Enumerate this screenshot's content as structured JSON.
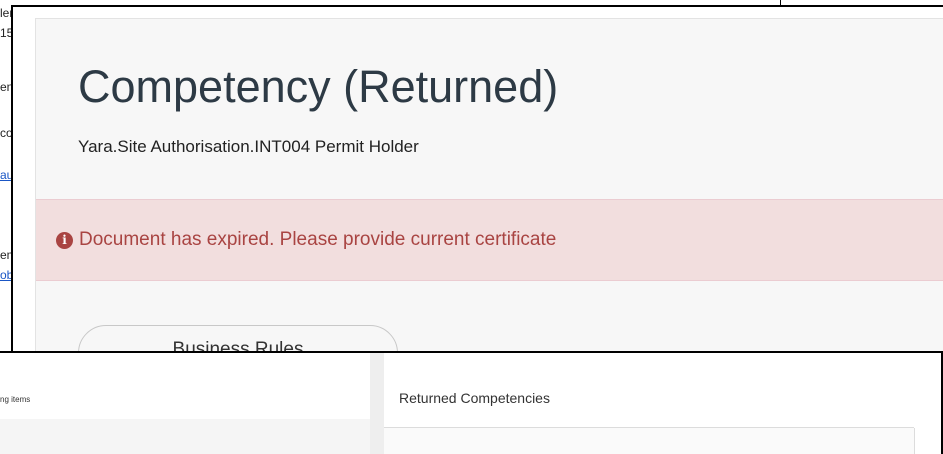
{
  "background_email": {
    "lines": [
      "ler",
      "15",
      "enc",
      "co",
      "au",
      "em",
      "ob"
    ]
  },
  "competency": {
    "title": "Competency (Returned)",
    "subtitle": "Yara.Site Authorisation.INT004 Permit Holder",
    "alert": {
      "icon": "info-circle-icon",
      "text": "Document has expired. Please provide current certificate",
      "color": "#a94442",
      "background": "#f2dede"
    },
    "business_rules_label": "Business Rules"
  },
  "lower_window": {
    "left_pane_label": "ng items",
    "right_pane_title": "Returned Competencies"
  }
}
